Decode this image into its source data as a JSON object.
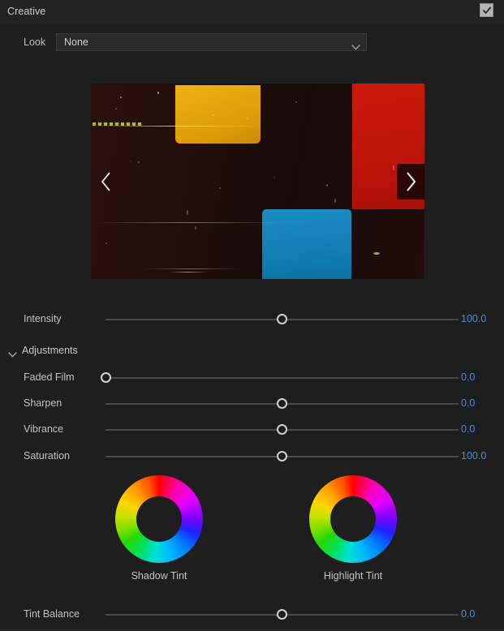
{
  "section": {
    "title": "Creative",
    "enabled": true,
    "checkbox_icon": "checkmark-icon"
  },
  "look": {
    "label": "Look",
    "value": "None",
    "placeholder": "None",
    "chevron_icon": "chevron-down-icon"
  },
  "preview": {
    "prev_icon": "chevron-left-icon",
    "next_icon": "chevron-right-icon",
    "colors": {
      "yellow": "#dc9c07",
      "red": "#b81208",
      "cyan": "#0f7cb0",
      "background": "#180c0a"
    }
  },
  "intensity": {
    "label": "Intensity",
    "value": "100.0",
    "thumb_percent": 50
  },
  "adjustments": {
    "label": "Adjustments",
    "expanded": true,
    "chevron_icon": "chevron-down-icon",
    "rows": [
      {
        "label": "Faded Film",
        "value": "0.0",
        "thumb_percent": 0
      },
      {
        "label": "Sharpen",
        "value": "0.0",
        "thumb_percent": 50
      },
      {
        "label": "Vibrance",
        "value": "0.0",
        "thumb_percent": 50
      },
      {
        "label": "Saturation",
        "value": "100.0",
        "thumb_percent": 50
      }
    ]
  },
  "wheels": [
    {
      "label": "Shadow Tint",
      "name": "shadow-tint-wheel"
    },
    {
      "label": "Highlight Tint",
      "name": "highlight-tint-wheel"
    }
  ],
  "tint_balance": {
    "label": "Tint Balance",
    "value": "0.0",
    "thumb_percent": 50
  },
  "theme": {
    "panel_bg": "#1e1e1e",
    "header_bg": "#232323",
    "text": "#c8c8c8",
    "value_blue": "#4e8fd4",
    "track": "#4b4b4b",
    "thumb_border": "#d2d2d2"
  }
}
